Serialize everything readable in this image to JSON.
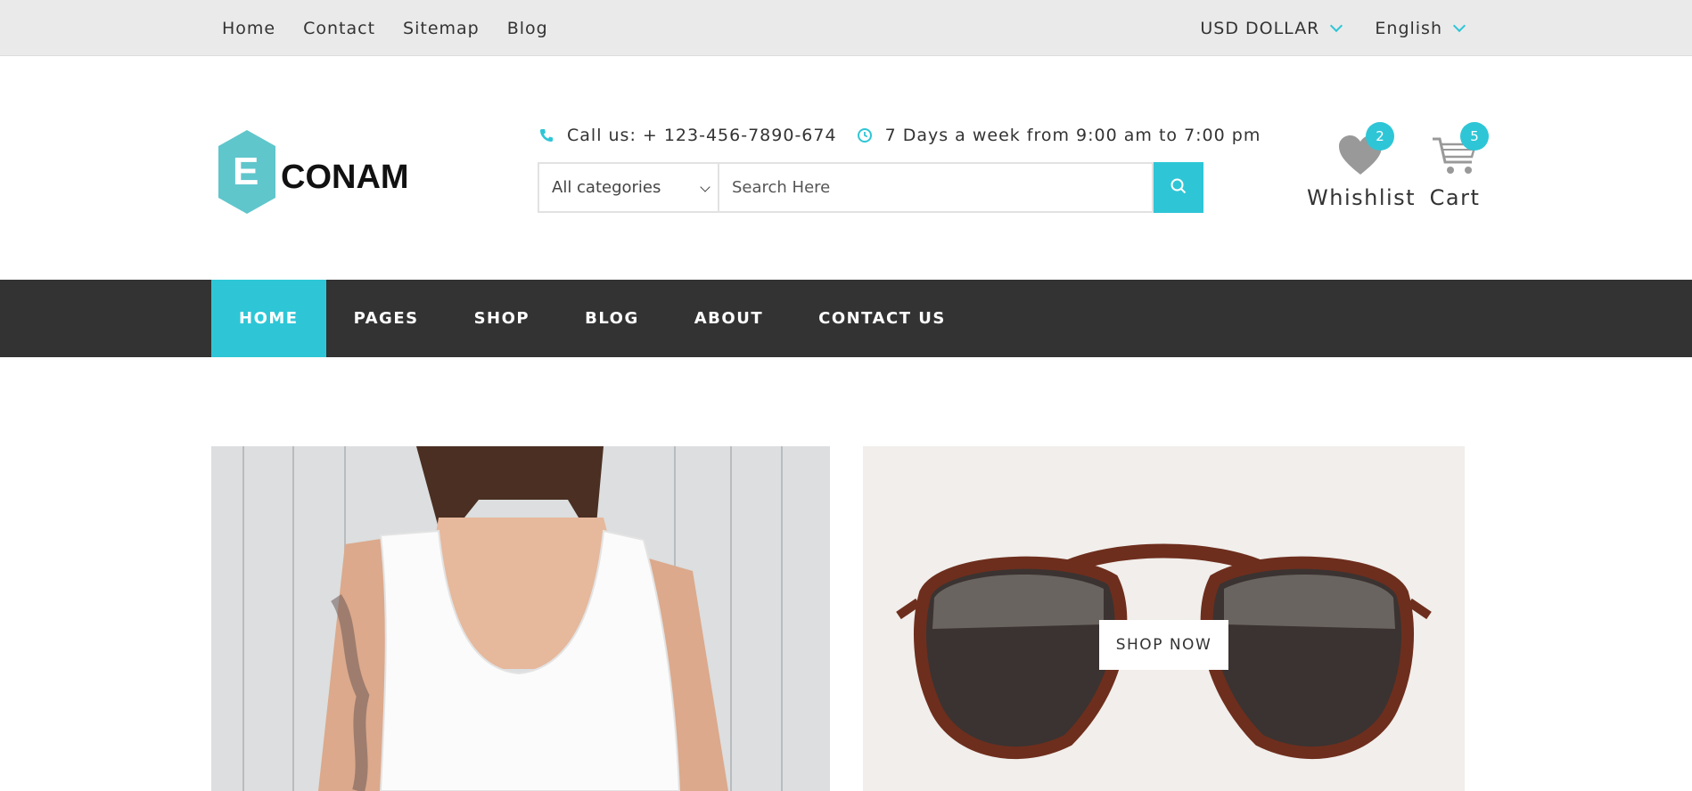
{
  "topbar": {
    "links": [
      "Home",
      "Contact",
      "Sitemap",
      "Blog"
    ],
    "currency": "USD DOLLAR",
    "language": "English"
  },
  "brand": {
    "logo_letter": "E",
    "logo_text": "CONAM"
  },
  "header": {
    "phone": "Call us: + 123-456-7890-674",
    "hours": "7 Days a week from 9:00 am to 7:00 pm",
    "category_select": "All categories",
    "search_placeholder": "Search Here",
    "wishlist_label": "Whishlist",
    "wishlist_count": "2",
    "cart_label": "Cart",
    "cart_count": "5"
  },
  "nav": {
    "items": [
      "HOME",
      "PAGES",
      "SHOP",
      "BLOG",
      "ABOUT",
      "CONTACT US"
    ],
    "active_index": 0
  },
  "banners": {
    "shop_now_label": "SHOP NOW"
  },
  "colors": {
    "accent": "#2ec6d6",
    "nav_bg": "#333333",
    "topbar_bg": "#eaeaea"
  }
}
